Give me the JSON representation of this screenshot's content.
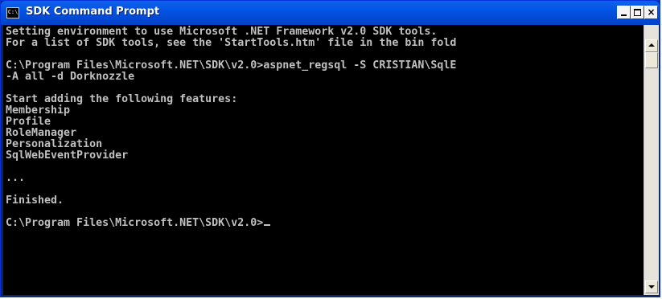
{
  "window": {
    "title": "SDK Command Prompt",
    "icon_name": "console-app-icon",
    "icon_text": "C:\\",
    "controls": {
      "minimize": "minimize-icon",
      "maximize": "maximize-icon",
      "close_label": "×"
    }
  },
  "console": {
    "text_color": "#c0c0c0",
    "background": "#000000",
    "lines": [
      "Setting environment to use Microsoft .NET Framework v2.0 SDK tools.",
      "For a list of SDK tools, see the 'StartTools.htm' file in the bin fold",
      "",
      "C:\\Program Files\\Microsoft.NET\\SDK\\v2.0>aspnet_regsql -S CRISTIAN\\SqlE",
      "-A all -d Dorknozzle",
      "",
      "Start adding the following features:",
      "Membership",
      "Profile",
      "RoleManager",
      "Personalization",
      "SqlWebEventProvider",
      "",
      "...",
      "",
      "Finished.",
      "",
      "C:\\Program Files\\Microsoft.NET\\SDK\\v2.0>"
    ]
  },
  "scrollbar": {
    "up_icon": "scroll-up-arrow-icon",
    "down_icon": "scroll-down-arrow-icon"
  }
}
